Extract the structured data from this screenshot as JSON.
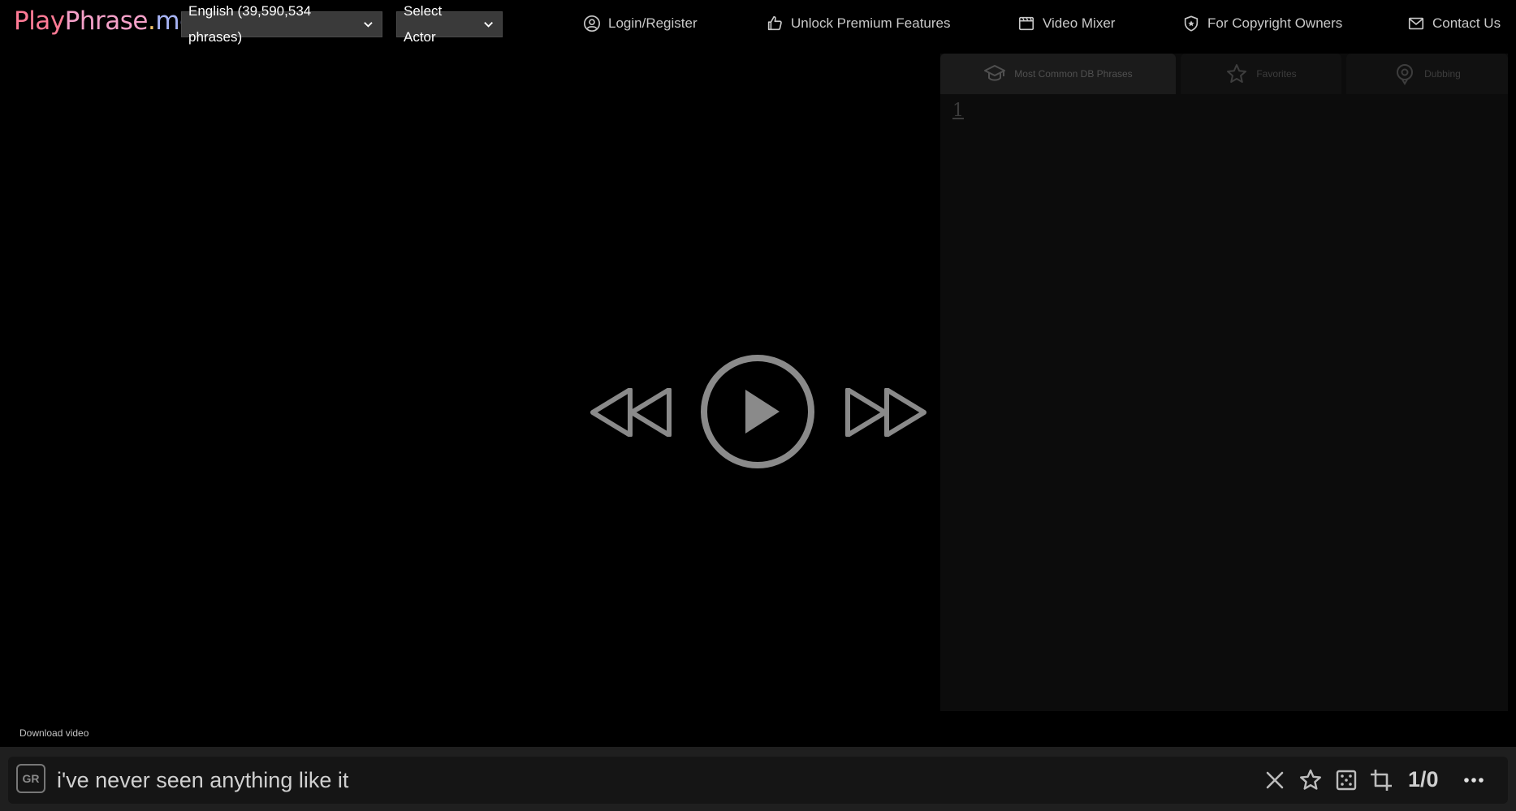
{
  "app": {
    "logo": {
      "part1": "Play",
      "part2": "Phrase",
      "part3": ".",
      "part4": "me"
    }
  },
  "header": {
    "language_select": "English (39,590,534 phrases)",
    "actor_select": "Select Actor",
    "nav": [
      {
        "label": "Login/Register",
        "icon": "user-circle-icon"
      },
      {
        "label": "Unlock Premium Features",
        "icon": "thumbs-up-icon"
      },
      {
        "label": "Video Mixer",
        "icon": "film-icon"
      },
      {
        "label": "For Copyright Owners",
        "icon": "shield-icon"
      },
      {
        "label": "Contact Us",
        "icon": "mail-icon"
      }
    ]
  },
  "player": {
    "download_label": "Download video",
    "controls": [
      "rewind-icon",
      "play-icon",
      "fast-forward-icon"
    ],
    "control_color": "#8a8a8a"
  },
  "side_panel": {
    "tabs": [
      {
        "label": "Most Common DB Phrases",
        "icon": "graduation-cap-icon",
        "active": true
      },
      {
        "label": "Favorites",
        "icon": "star-icon",
        "active": false
      },
      {
        "label": "Dubbing",
        "icon": "location-icon",
        "active": false
      }
    ],
    "list_number": "1"
  },
  "search_bar": {
    "badge": "GR",
    "query": "i've never seen anything like it",
    "counter": "1/0",
    "icons": [
      "close-icon",
      "star-icon",
      "dice-icon",
      "crop-icon",
      "more-icon"
    ]
  },
  "colors": {
    "background": "#000000",
    "select_bg": "#3a3a3a",
    "panel_bg": "#0c0c0c",
    "bar_bg": "#1f1f1f"
  }
}
